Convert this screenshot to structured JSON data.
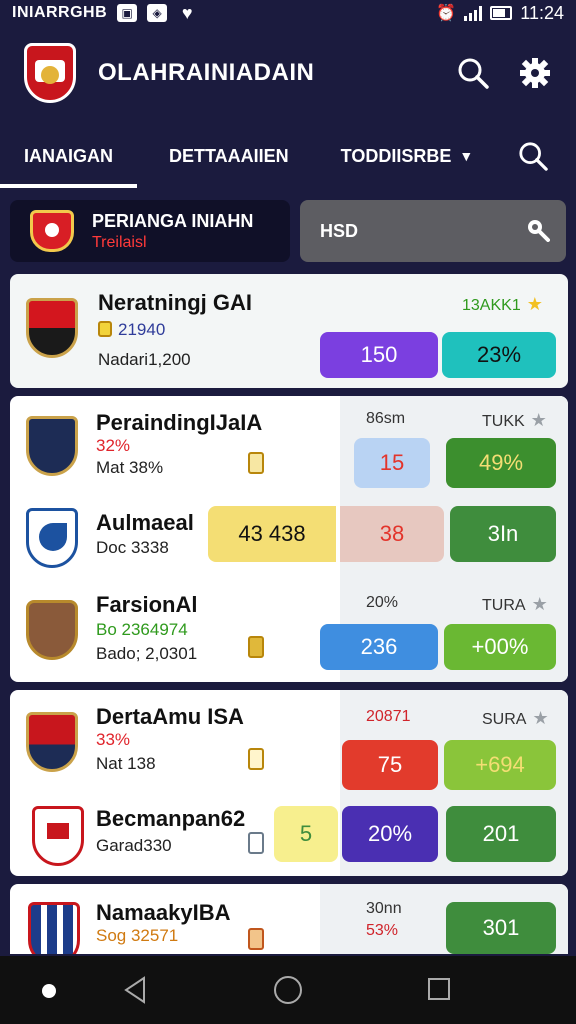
{
  "status_bar": {
    "carrier": "INIARRGHB",
    "time": "11:24"
  },
  "header": {
    "title": "OLAHRAINIADAIN"
  },
  "tabs": [
    {
      "label": "IANAIGAN",
      "active": true
    },
    {
      "label": "DETTAAAIIEN",
      "active": false
    },
    {
      "label": "TODDIISRBE",
      "active": false,
      "dropdown": true
    }
  ],
  "summary": {
    "title": "PERIANGA INIAHN",
    "subtitle": "Treilaisl"
  },
  "search": {
    "value": "HSD"
  },
  "colors": {
    "purple": "#7b3fe0",
    "teal": "#1fc1bd",
    "light_blue": "#b9d3f3",
    "red_text": "#e3342b",
    "dark_green": "#3c8f2e",
    "yellow": "#f4de74",
    "rose": "#e7c8c0",
    "green": "#3f8d3d",
    "blue": "#3f8ee0",
    "lime": "#6ab833",
    "red": "#e23b2c",
    "chartreuse": "#8ac53a",
    "pale_yellow": "#f7ef8e",
    "indigo": "#4a2fb2"
  },
  "featured": {
    "name": "Neratningj GAI",
    "stat": "21940",
    "meta": "Nadari1,200",
    "badge": "13AKK1",
    "values": [
      "150",
      "23%"
    ]
  },
  "group1": {
    "head_left": "86sm",
    "head_right": "TUKK",
    "teams": [
      {
        "name": "PeraindingIJaIA",
        "stat": "32%",
        "meta": "Mat 38%",
        "values": [
          "15",
          "49%"
        ]
      },
      {
        "name": "Aulmaeal",
        "stat": "",
        "meta": "Doc 3338",
        "values": [
          "43 438",
          "38",
          "3In"
        ]
      },
      {
        "name": "FarsionAl",
        "stat": "Bo 2364974",
        "meta": "Bado; 2,0301",
        "head_left": "20%",
        "head_right": "TURA",
        "values": [
          "236",
          "+00%"
        ]
      }
    ]
  },
  "group2": {
    "head_left": "20871",
    "head_right": "SURA",
    "teams": [
      {
        "name": "DertaAmu ISA",
        "stat": "33%",
        "meta": "Nat 138",
        "values": [
          "75",
          "+694"
        ]
      },
      {
        "name": "Becmanpan62",
        "stat": "",
        "meta": "Garad330",
        "values": [
          "5",
          "20%",
          "201"
        ]
      }
    ]
  },
  "group3": {
    "head_left": "30nn",
    "teams": [
      {
        "name": "NamaakyIBA",
        "stat": "Sog 32571",
        "stat2": "53%",
        "values": [
          "301"
        ]
      }
    ]
  }
}
